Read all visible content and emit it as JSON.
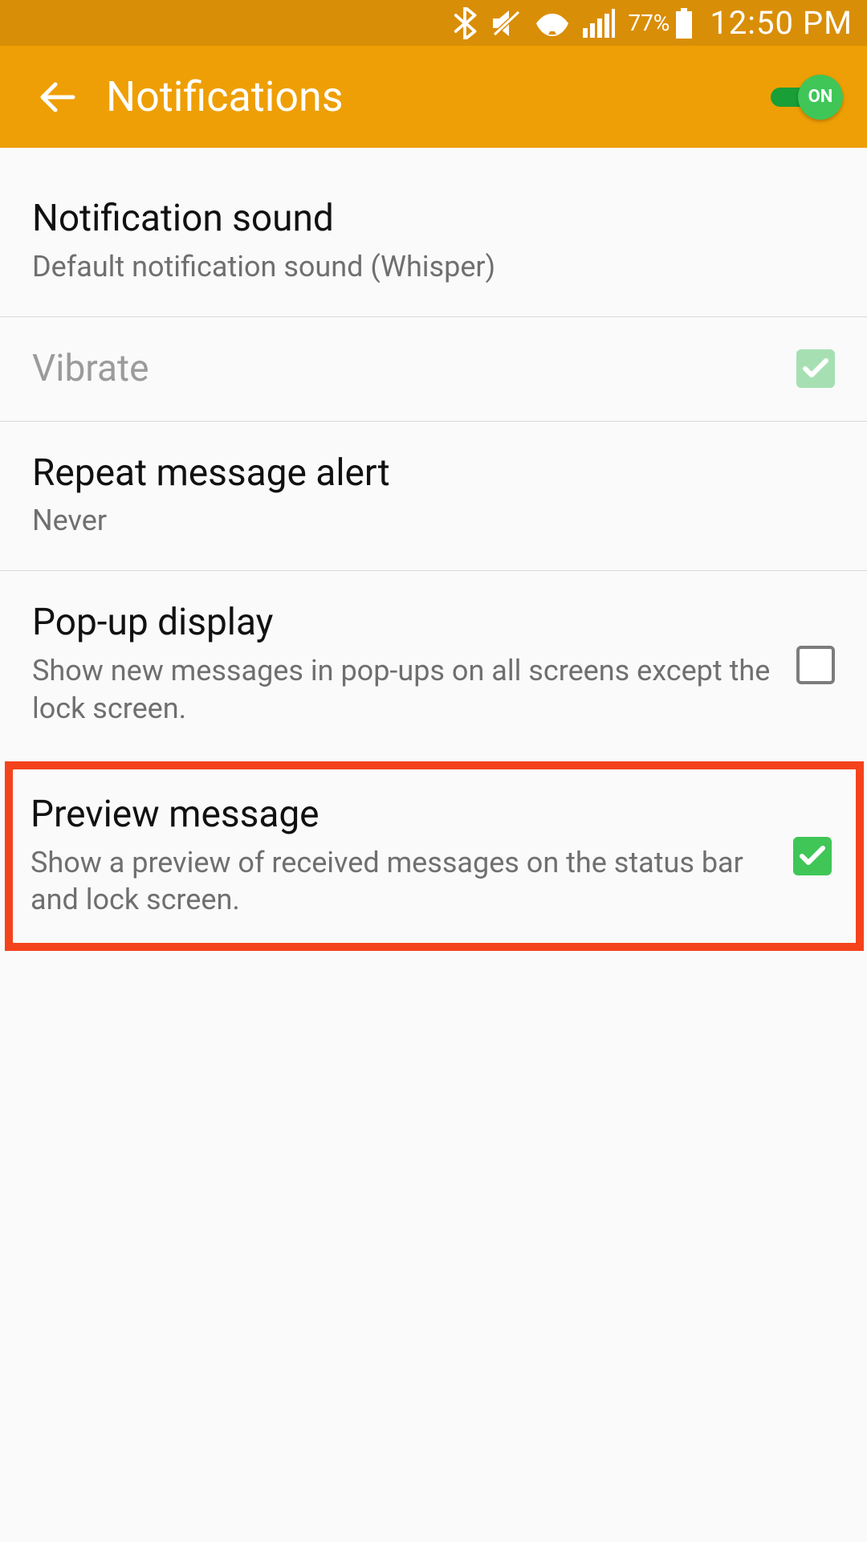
{
  "status": {
    "battery_pct": "77%",
    "time": "12:50 PM"
  },
  "header": {
    "title": "Notifications",
    "toggle_label": "ON",
    "toggle_state": true
  },
  "items": {
    "notification_sound": {
      "title": "Notification sound",
      "subtitle": "Default notification sound (Whisper)"
    },
    "vibrate": {
      "title": "Vibrate",
      "checked": true,
      "disabled": true
    },
    "repeat_alert": {
      "title": "Repeat message alert",
      "subtitle": "Never"
    },
    "popup_display": {
      "title": "Pop-up display",
      "subtitle": "Show new messages in pop-ups on all screens except the lock screen.",
      "checked": false
    },
    "preview_message": {
      "title": "Preview message",
      "subtitle": "Show a preview of received messages on the status bar and lock screen.",
      "checked": true
    }
  }
}
